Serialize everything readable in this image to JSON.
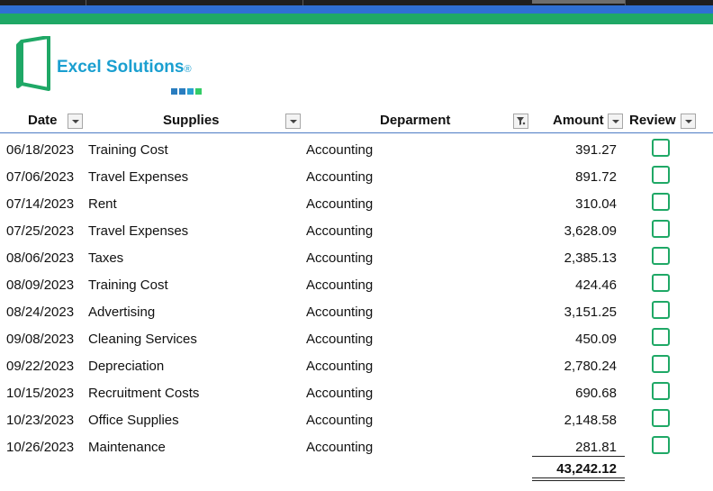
{
  "brand": {
    "name": "Excel Solutions",
    "reg_mark": "®",
    "colors": {
      "icon": "#1fa866",
      "text": "#1a9fd0",
      "dots": [
        "#2a7dbf",
        "#2a7dbf",
        "#2a9fd0",
        "#33cc66"
      ]
    }
  },
  "theme": {
    "blue_band": "#2f6fd3",
    "green_band": "#1fa866",
    "checkbox": "#1fa866",
    "header_rule": "#4d7cc4"
  },
  "columns": {
    "date": "Date",
    "supplies": "Supplies",
    "department": "Deparment",
    "amount": "Amount",
    "reviewed": "Review"
  },
  "filter": {
    "active_column": "department",
    "icon": "filter-funnel-icon"
  },
  "rows": [
    {
      "date": "06/18/2023",
      "supply": "Training Cost",
      "department": "Accounting",
      "amount": "391.27",
      "reviewed": false
    },
    {
      "date": "07/06/2023",
      "supply": "Travel Expenses",
      "department": "Accounting",
      "amount": "891.72",
      "reviewed": false
    },
    {
      "date": "07/14/2023",
      "supply": "Rent",
      "department": "Accounting",
      "amount": "310.04",
      "reviewed": false
    },
    {
      "date": "07/25/2023",
      "supply": "Travel Expenses",
      "department": "Accounting",
      "amount": "3,628.09",
      "reviewed": false
    },
    {
      "date": "08/06/2023",
      "supply": "Taxes",
      "department": "Accounting",
      "amount": "2,385.13",
      "reviewed": false
    },
    {
      "date": "08/09/2023",
      "supply": "Training Cost",
      "department": "Accounting",
      "amount": "424.46",
      "reviewed": false
    },
    {
      "date": "08/24/2023",
      "supply": "Advertising",
      "department": "Accounting",
      "amount": "3,151.25",
      "reviewed": false
    },
    {
      "date": "09/08/2023",
      "supply": "Cleaning Services",
      "department": "Accounting",
      "amount": "450.09",
      "reviewed": false
    },
    {
      "date": "09/22/2023",
      "supply": "Depreciation",
      "department": "Accounting",
      "amount": "2,780.24",
      "reviewed": false
    },
    {
      "date": "10/15/2023",
      "supply": "Recruitment Costs",
      "department": "Accounting",
      "amount": "690.68",
      "reviewed": false
    },
    {
      "date": "10/23/2023",
      "supply": "Office Supplies",
      "department": "Accounting",
      "amount": "2,148.58",
      "reviewed": false
    },
    {
      "date": "10/26/2023",
      "supply": "Maintenance",
      "department": "Accounting",
      "amount": "281.81",
      "reviewed": false
    }
  ],
  "total": "43,242.12"
}
